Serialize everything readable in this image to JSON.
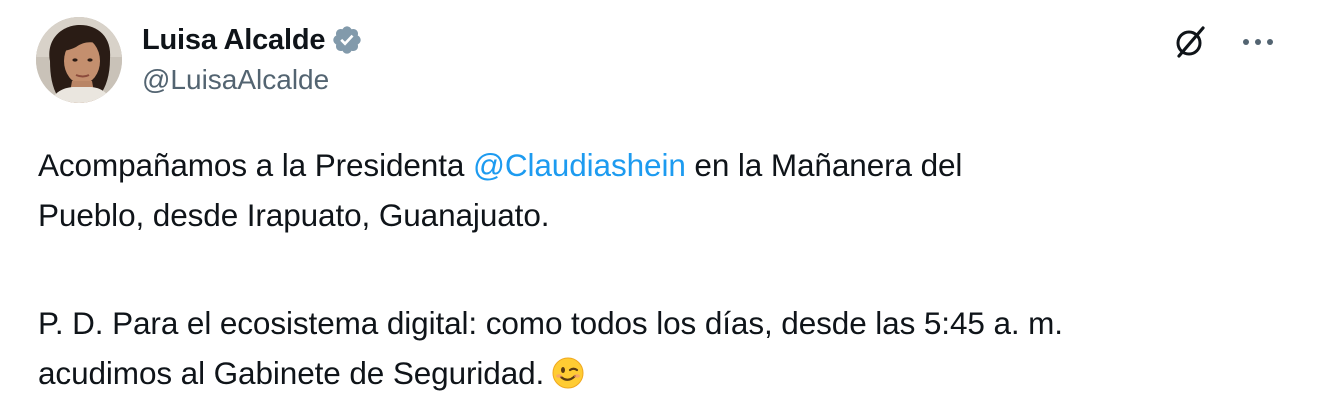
{
  "author": {
    "display_name": "Luisa Alcalde",
    "handle": "@LuisaAlcalde",
    "verified": true,
    "verified_badge_color": "#1d9bf0"
  },
  "header_actions": {
    "grok_icon": "grok-icon",
    "more_icon": "more-icon"
  },
  "tweet": {
    "para1_part1": "Acompañamos a la Presidenta ",
    "para1_mention": "@Claudiashein",
    "para1_part2": " en la Mañanera del",
    "para1_line2": "Pueblo, desde Irapuato, Guanajuato.",
    "para2_line1": "P. D. Para el ecosistema digital: como todos los días, desde las 5:45 a. m.",
    "para2_line2": "acudimos al Gabinete de Seguridad.",
    "emoji": "winking-face-emoji"
  },
  "colors": {
    "text": "#0f1419",
    "secondary": "#536471",
    "link": "#1d9bf0"
  }
}
